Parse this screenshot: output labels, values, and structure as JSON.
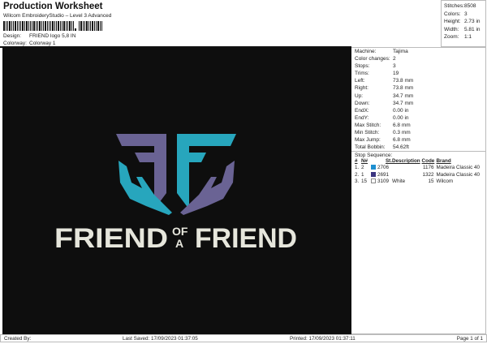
{
  "header": {
    "title": "Production Worksheet",
    "subtitle": "Wilcom EmbroideryStudio – Level 3 Advanced",
    "design_label": "Design:",
    "design_value": "FRIEND logo 5,8 IN",
    "colorway_label": "Colorway:",
    "colorway_value": "Colorway 1"
  },
  "stats": [
    {
      "k": "Stitches:",
      "v": "8508"
    },
    {
      "k": "Colors:",
      "v": "3"
    },
    {
      "k": "Height:",
      "v": "2.73 in"
    },
    {
      "k": "Width:",
      "v": "5.81 in"
    },
    {
      "k": "Zoom:",
      "v": "1:1"
    }
  ],
  "logo": {
    "line1": "FRIEND",
    "small_top": "OF",
    "small_bottom": "A",
    "line2": "FRIEND",
    "colors": {
      "cyan": "#27a6bd",
      "purple": "#6a6394",
      "white": "#e6e6dc"
    }
  },
  "details": [
    {
      "k": "Machine:",
      "v": "Tajima"
    },
    {
      "k": "Color changes:",
      "v": "2"
    },
    {
      "k": "Stops:",
      "v": "3"
    },
    {
      "k": "Trims:",
      "v": "19"
    },
    {
      "k": "Left:",
      "v": "73.8 mm"
    },
    {
      "k": "Right:",
      "v": "73.8 mm"
    },
    {
      "k": "Up:",
      "v": "34.7 mm"
    },
    {
      "k": "Down:",
      "v": "34.7 mm"
    },
    {
      "k": "EndX:",
      "v": "0.00 in"
    },
    {
      "k": "EndY:",
      "v": "0.00 in"
    },
    {
      "k": "Max Stitch:",
      "v": "6.8 mm"
    },
    {
      "k": "Min Stitch:",
      "v": "0.3 mm"
    },
    {
      "k": "Max Jump:",
      "v": "6.8 mm"
    },
    {
      "k": "Total Bobbin:",
      "v": "54.62ft"
    }
  ],
  "stop_sequence": {
    "title": "Stop Sequence:",
    "headers": [
      "#",
      "N#",
      "St.",
      "Description",
      "Code",
      "Brand"
    ],
    "rows": [
      {
        "n": "1.",
        "nn": "2",
        "color": "#1e8fd0",
        "st": "2706",
        "desc": "",
        "code": "1176",
        "brand": "Madeira Classic 40"
      },
      {
        "n": "2.",
        "nn": "1",
        "color": "#3a3480",
        "st": "2691",
        "desc": "",
        "code": "1322",
        "brand": "Madeira Classic 40"
      },
      {
        "n": "3.",
        "nn": "15",
        "color": "#ffffff",
        "st": "3109",
        "desc": "White",
        "code": "15",
        "brand": "Wilcom"
      }
    ]
  },
  "footer": {
    "created": "Created By:",
    "saved": "Last Saved: 17/09/2023 01:37:05",
    "printed": "Printed: 17/09/2023 01:37:11",
    "page": "Page 1 of 1"
  }
}
